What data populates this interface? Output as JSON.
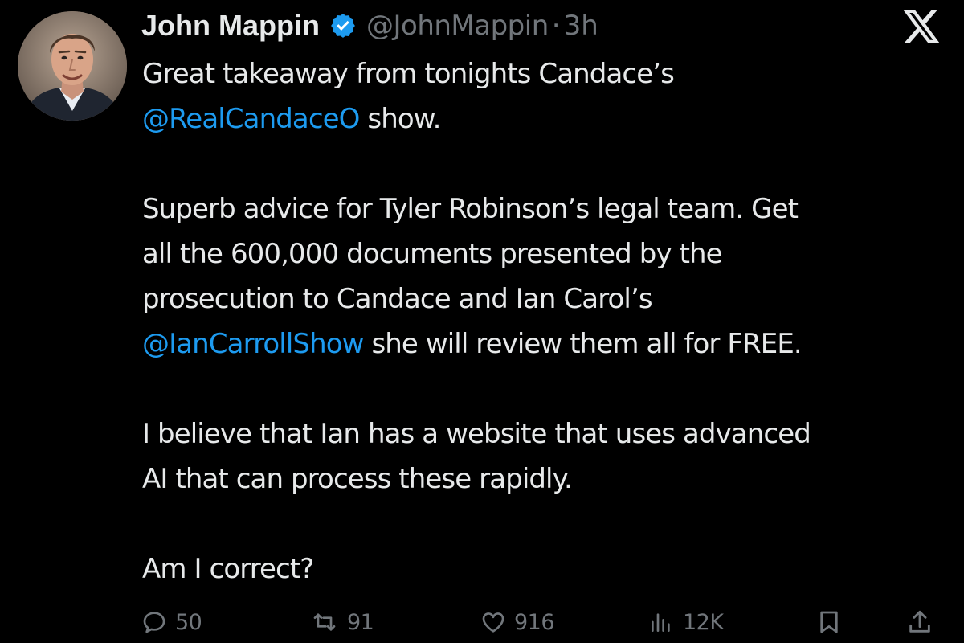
{
  "author": {
    "display_name": "John Mappin",
    "handle": "@JohnMappin",
    "separator": "·",
    "time": "3h"
  },
  "icons": {
    "verified": "verified-badge-icon",
    "platform": "x-logo-icon"
  },
  "colors": {
    "background": "#000000",
    "text": "#e7e9ea",
    "secondary": "#71767b",
    "mention": "#1d9bf0"
  },
  "tweet": {
    "p1": {
      "l1": "Great takeaway from tonights Candace’s",
      "l2_mention": "@RealCandaceO",
      "l2_text": " show."
    },
    "p2": {
      "l1": "Superb advice for Tyler Robinson’s legal team.  Get",
      "l2": "all the 600,000 documents presented by the",
      "l3": "prosecution to Candace and Ian Carol’s",
      "l4_mention": "@IanCarrollShow",
      "l4_text": " she will review them all for FREE."
    },
    "p3": {
      "l1": "I believe that Ian has a website that uses advanced",
      "l2": "AI that can process these rapidly."
    },
    "p4": {
      "l1": "Am I correct?"
    }
  },
  "actions": {
    "replies": "50",
    "reposts": "91",
    "likes": "916",
    "views": "12K"
  }
}
